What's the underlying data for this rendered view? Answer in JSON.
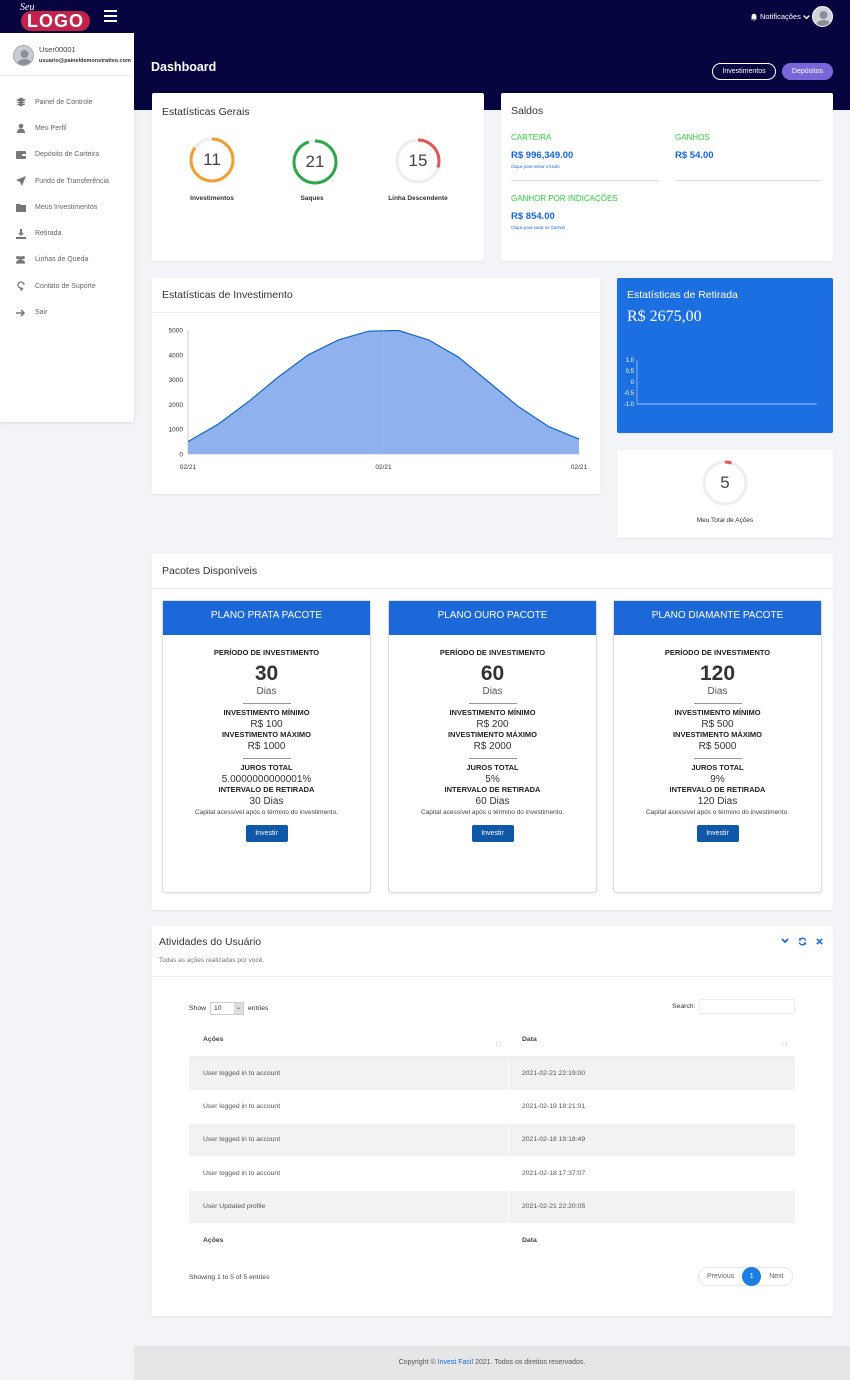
{
  "brand": {
    "top": "Seu",
    "main": "LOGO"
  },
  "header": {
    "notifications": "Notificações",
    "page_title": "Dashboard",
    "btn_investments": "Investimentos",
    "btn_deposits": "Depósitos"
  },
  "user": {
    "name": "User00001",
    "email": "usuario@paineldemonstrativo.com"
  },
  "sidebar": {
    "items": [
      {
        "label": "Painel de Controle",
        "icon": "layers-icon"
      },
      {
        "label": "Meu Perfil",
        "icon": "user-icon"
      },
      {
        "label": "Depósito de Carteira",
        "icon": "wallet-icon"
      },
      {
        "label": "Fundo de Transferência",
        "icon": "send-icon"
      },
      {
        "label": "Meus Investimentos",
        "icon": "folder-icon"
      },
      {
        "label": "Retirada",
        "icon": "download-icon"
      },
      {
        "label": "Linhas de Queda",
        "icon": "users-icon"
      },
      {
        "label": "Contato de Suporte",
        "icon": "support-icon"
      },
      {
        "label": "Sair",
        "icon": "arrow-right-icon"
      }
    ]
  },
  "stats": {
    "title": "Estatísticas Gerais",
    "items": [
      {
        "value": "11",
        "label": "Investimentos",
        "color": "#f0a030",
        "fraction": 0.85
      },
      {
        "value": "21",
        "label": "Saques",
        "color": "#2ea84a",
        "fraction": 0.95
      },
      {
        "value": "15",
        "label": "Linha Descendente",
        "color": "#e55555",
        "fraction": 0.3
      }
    ]
  },
  "saldos": {
    "title": "Saldos",
    "carteira": {
      "label": "CARTEIRA",
      "value": "R$ 996,349.00",
      "note": "Clique para retirar o fundo"
    },
    "ganhos": {
      "label": "GANHOS",
      "value": "R$ 54.00"
    },
    "indicacoes": {
      "label": "GANHOR POR INDICAÇÕES",
      "value": "R$ 854.00",
      "note": "Clique para sacar os Ganhos"
    },
    "label_color": "#2ecc40"
  },
  "invest_chart": {
    "title": "Estatísticas de Investimento"
  },
  "chart_data": [
    {
      "type": "area",
      "title": "Estatísticas de Investimento",
      "x": [
        "02/21",
        "02/21",
        "02/21"
      ],
      "x_positions": [
        0,
        0.5,
        1
      ],
      "curve_y": [
        500,
        1200,
        2100,
        3100,
        4000,
        4600,
        4950,
        4980,
        4600,
        3900,
        2900,
        1900,
        1100,
        600
      ],
      "yticks": [
        0,
        1000,
        2000,
        3000,
        4000,
        5000
      ],
      "ylim": [
        0,
        5000
      ],
      "color": "#8fb2ee"
    },
    {
      "type": "line",
      "title": "Estatísticas de Retirada",
      "yticks": [
        "1.0",
        "0.5",
        "0",
        "-0.5",
        "-1.0"
      ],
      "values": [
        0,
        0,
        0,
        0
      ]
    }
  ],
  "withdraw": {
    "title": "Estatísticas de Retirada",
    "value": "R$ 2675,00"
  },
  "actions": {
    "value": "5",
    "label": "Meu Total de Ações",
    "fraction": 0.05
  },
  "packages": {
    "title": "Pacotes Disponíveis",
    "plans": [
      {
        "name": "PLANO PRATA PACOTE",
        "period_label": "PERÍODO DE INVESTIMENTO",
        "days": "30",
        "days_unit": "Dias",
        "min_label": "INVESTIMENTO MÍNIMO",
        "min": "R$ 100",
        "max_label": "INVESTIMENTO MÁXIMO",
        "max": "R$ 1000",
        "interest_label": "JUROS TOTAL",
        "interest": "5.0000000000001%",
        "interval_label": "INTERVALO DE RETIRADA",
        "interval": "30 Dias",
        "note": "Capital acessível após o término do investimento.",
        "btn": "Investir"
      },
      {
        "name": "PLANO OURO PACOTE",
        "period_label": "PERÍODO DE INVESTIMENTO",
        "days": "60",
        "days_unit": "Dias",
        "min_label": "INVESTIMENTO MÍNIMO",
        "min": "R$ 200",
        "max_label": "INVESTIMENTO MÁXIMO",
        "max": "R$ 2000",
        "interest_label": "JUROS TOTAL",
        "interest": "5%",
        "interval_label": "INTERVALO DE RETIRADA",
        "interval": "60 Dias",
        "note": "Capital acessível após o término do investimento.",
        "btn": "Investir"
      },
      {
        "name": "PLANO DIAMANTE PACOTE",
        "period_label": "PERÍODO DE INVESTIMENTO",
        "days": "120",
        "days_unit": "Dias",
        "min_label": "INVESTIMENTO MÍNIMO",
        "min": "R$ 500",
        "max_label": "INVESTIMENTO MÁXIMO",
        "max": "R$ 5000",
        "interest_label": "JUROS TOTAL",
        "interest": "9%",
        "interval_label": "INTERVALO DE RETIRADA",
        "interval": "120 Dias",
        "note": "Capital acessível após o término do investimento.",
        "btn": "Investir"
      }
    ]
  },
  "activities": {
    "title": "Atividades do Usuário",
    "subtitle": "Todas as ações realizadas por você.",
    "show": "Show",
    "entries_value": "10",
    "entries": "entries",
    "search": "Search:",
    "columns": [
      "Ações",
      "Data"
    ],
    "rows": [
      {
        "action": "User logged in to account",
        "date": "2021-02-21 22:19:00"
      },
      {
        "action": "User logged in to account",
        "date": "2021-02-19 18:21:01"
      },
      {
        "action": "User logged in to account",
        "date": "2021-02-18 19:18:49"
      },
      {
        "action": "User logged in to account",
        "date": "2021-02-18 17:37:07"
      },
      {
        "action": "User Updated profile",
        "date": "2021-02-21 22:20:05"
      }
    ],
    "info": "Showing 1 to 5 of 5 entries",
    "prev": "Previous",
    "page": "1",
    "next": "Next"
  },
  "footer": {
    "prefix": "Copyright © ",
    "brand": "Invest Facil",
    "suffix": " 2021. Todos os direitos reservados."
  }
}
